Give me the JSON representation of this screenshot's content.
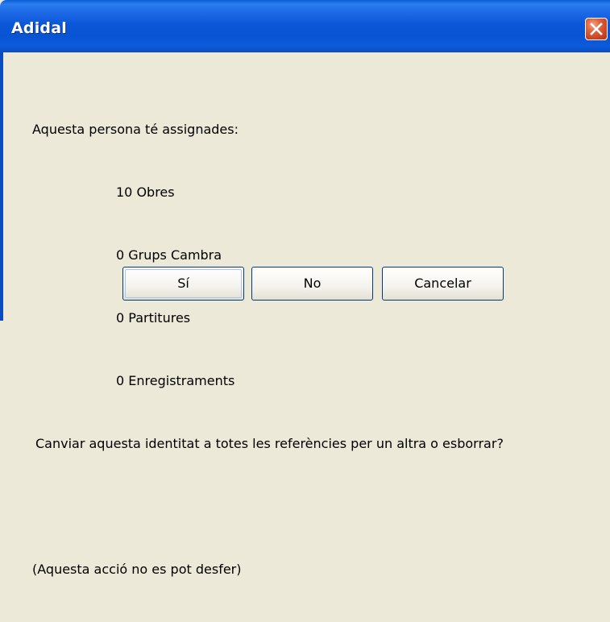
{
  "dialog": {
    "title": "Adidal",
    "message": {
      "intro": "Aquesta persona té assignades:",
      "items": [
        "10 Obres",
        "0 Grups Cambra",
        "0 Partitures",
        "0 Enregistraments"
      ],
      "question": "Canviar aquesta identitat a totes les referències per un altra o esborrar?",
      "warning": "(Aquesta acció no es pot desfer)"
    },
    "buttons": {
      "yes": "Sí",
      "no": "No",
      "cancel": "Cancelar"
    }
  },
  "colors": {
    "titlebar": "#0854D4",
    "close_button": "#E0613D",
    "dialog_background": "#ECE9D8"
  },
  "icons": {
    "close": "close-icon"
  }
}
